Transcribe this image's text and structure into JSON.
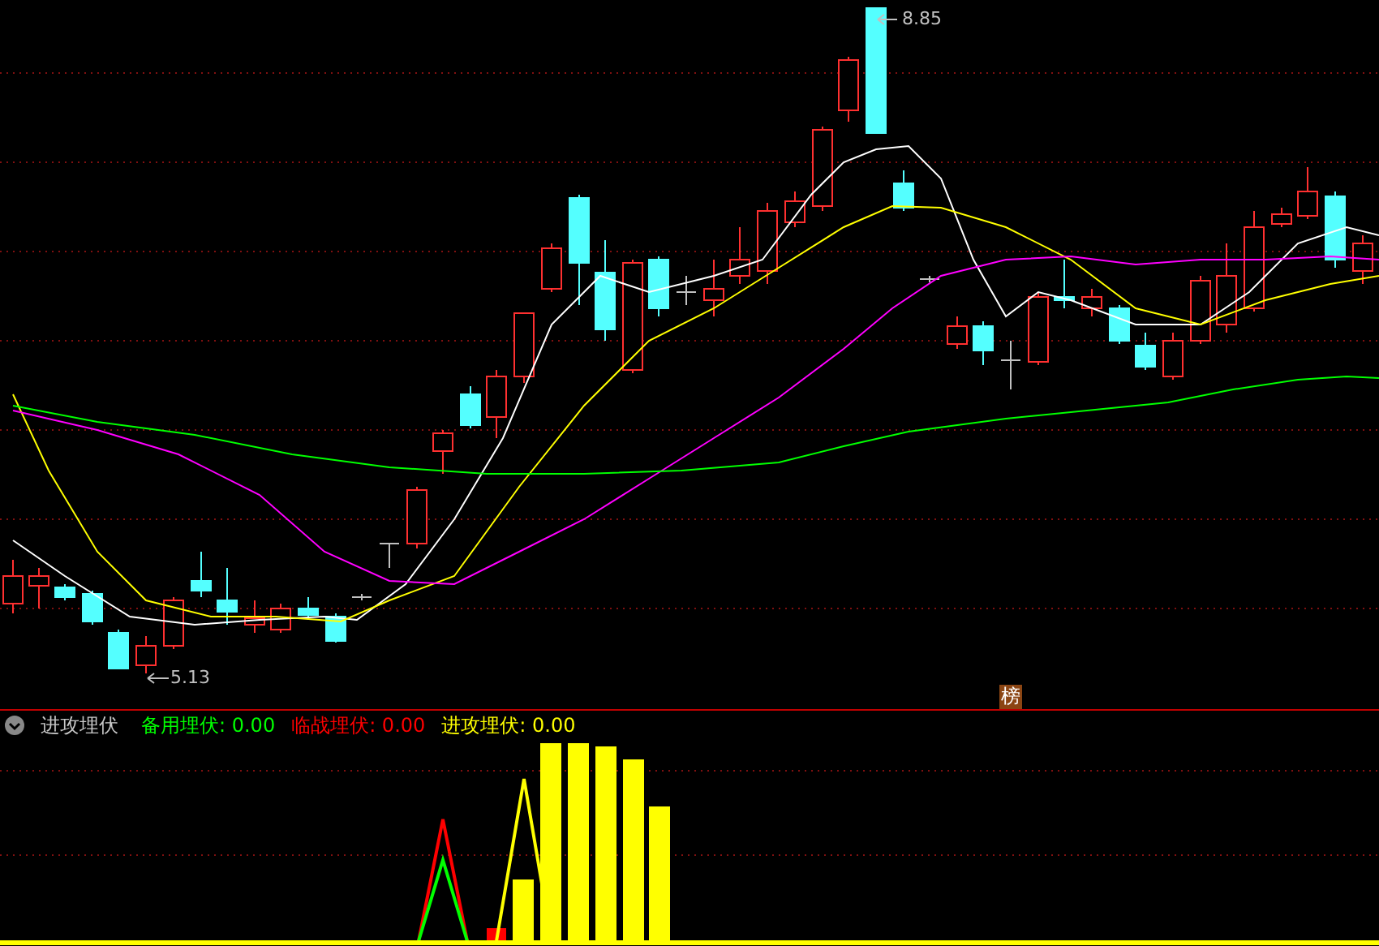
{
  "price_chart": {
    "high_label": "8.85",
    "low_label": "5.13",
    "badge": "榜"
  },
  "indicator": {
    "title": "进攻埋伏",
    "legend": [
      {
        "text": "备用埋伏: 0.00",
        "color": "#00ff00"
      },
      {
        "text": "临战埋伏: 0.00",
        "color": "#ff0000"
      },
      {
        "text": "进攻埋伏: 0.00",
        "color": "#ffff00"
      }
    ]
  }
}
